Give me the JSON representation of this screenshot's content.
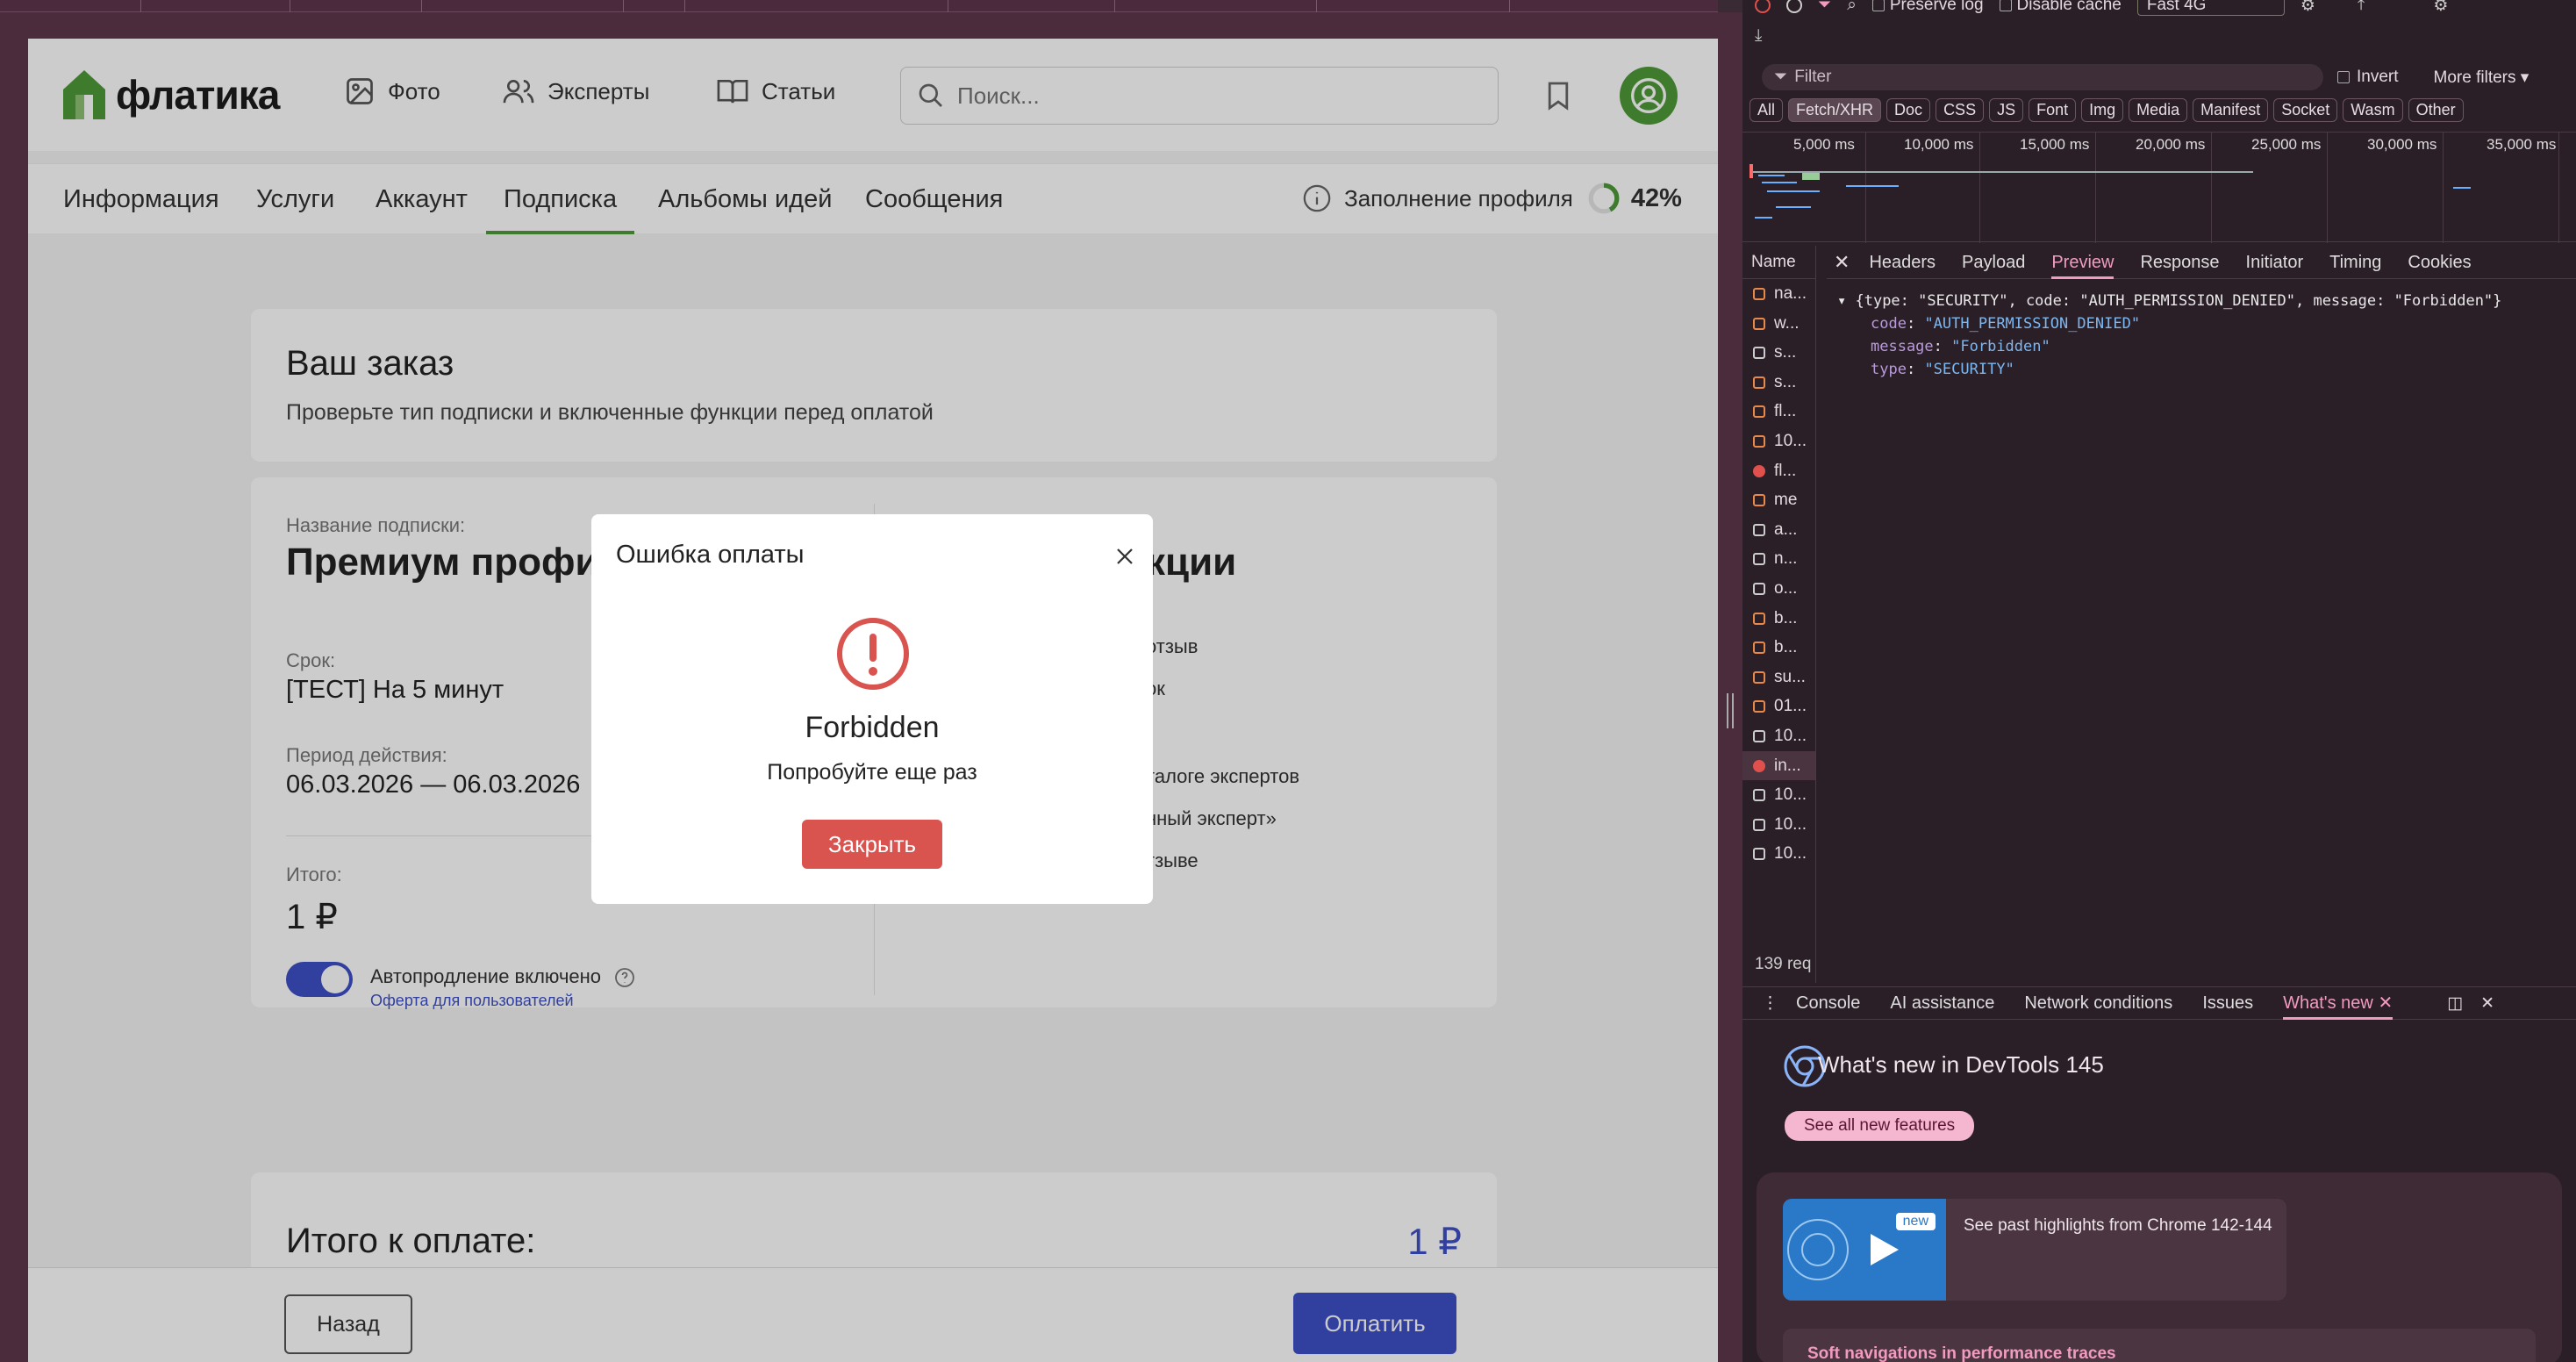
{
  "app": {
    "logo_text": "флатика",
    "nav": {
      "photo": "Фото",
      "experts": "Эксперты",
      "articles": "Статьи"
    },
    "search_placeholder": "Поиск...",
    "tabs": [
      "Информация",
      "Услуги",
      "Аккаунт",
      "Подписка",
      "Альбомы идей",
      "Сообщения"
    ],
    "active_tab": "Подписка",
    "profile_fill": {
      "label": "Заполнение профиля",
      "value": "42%",
      "fraction": 0.42
    },
    "order": {
      "title": "Ваш заказ",
      "subtitle": "Проверьте тип подписки и включенные функции перед оплатой"
    },
    "details": {
      "name_label": "Название подписки:",
      "name_value": "Премиум профиль",
      "term_label": "Срок:",
      "term_value": "[ТЕСТ] На 5 минут",
      "period_label": "Период действия:",
      "period_value": "06.03.2026 — 06.03.2026",
      "total_label": "Итого:",
      "total_value": "1 ₽",
      "autorenew": "Автопродление включено",
      "offer_link": "Оферта для пользователей",
      "features_title_fragment": "кции",
      "features": [
        "отзыв",
        "ок",
        "талоге экспертов",
        "нный эксперт»",
        "тзыве"
      ]
    },
    "total_to_pay": {
      "label": "Итого к оплате:",
      "value": "1 ₽"
    },
    "back_button": "Назад",
    "pay_button": "Оплатить",
    "modal": {
      "title": "Ошибка оплаты",
      "heading": "Forbidden",
      "message": "Попробуйте еще раз",
      "button": "Закрыть"
    },
    "colors": {
      "brand": "#4f9a38",
      "primary": "#3e4fc7",
      "error": "#d9534f"
    }
  },
  "devtools": {
    "toolbar": {
      "preserve_log": "Preserve log",
      "disable_cache": "Disable cache",
      "throttle": "Fast 4G"
    },
    "filter_placeholder": "Filter",
    "invert": "Invert",
    "more_filters": "More filters",
    "type_filters": [
      "All",
      "Fetch/XHR",
      "Doc",
      "CSS",
      "JS",
      "Font",
      "Img",
      "Media",
      "Manifest",
      "Socket",
      "Wasm",
      "Other"
    ],
    "active_type": "Fetch/XHR",
    "timeline_labels": [
      "5,000 ms",
      "10,000 ms",
      "15,000 ms",
      "20,000 ms",
      "25,000 ms",
      "30,000 ms",
      "35,000 ms"
    ],
    "name_header": "Name",
    "requests": [
      {
        "name": "na...",
        "icon": "xhr"
      },
      {
        "name": "w...",
        "icon": "xhr"
      },
      {
        "name": "s...",
        "icon": "doc"
      },
      {
        "name": "s...",
        "icon": "xhr"
      },
      {
        "name": "fl...",
        "icon": "img"
      },
      {
        "name": "10...",
        "icon": "xhr"
      },
      {
        "name": "fl...",
        "icon": "error"
      },
      {
        "name": "me",
        "icon": "xhr"
      },
      {
        "name": "a...",
        "icon": "doc"
      },
      {
        "name": "n...",
        "icon": "doc"
      },
      {
        "name": "o...",
        "icon": "doc"
      },
      {
        "name": "b...",
        "icon": "xhr"
      },
      {
        "name": "b...",
        "icon": "xhr"
      },
      {
        "name": "su...",
        "icon": "xhr"
      },
      {
        "name": "01...",
        "icon": "xhr"
      },
      {
        "name": "10...",
        "icon": "doc"
      },
      {
        "name": "in...",
        "icon": "error",
        "selected": true
      },
      {
        "name": "10...",
        "icon": "doc"
      },
      {
        "name": "10...",
        "icon": "doc"
      },
      {
        "name": "10...",
        "icon": "doc"
      }
    ],
    "detail_tabs": [
      "Headers",
      "Payload",
      "Preview",
      "Response",
      "Initiator",
      "Timing",
      "Cookies"
    ],
    "active_detail_tab": "Preview",
    "preview": {
      "summary": "{type: \"SECURITY\", code: \"AUTH_PERMISSION_DENIED\", message: \"Forbidden\"}",
      "fields": [
        {
          "key": "code",
          "value": "\"AUTH_PERMISSION_DENIED\""
        },
        {
          "key": "message",
          "value": "\"Forbidden\""
        },
        {
          "key": "type",
          "value": "\"SECURITY\""
        }
      ]
    },
    "request_count": "139 req",
    "drawer_tabs": [
      "Console",
      "AI assistance",
      "Network conditions",
      "Issues",
      "What's new"
    ],
    "active_drawer_tab": "What's new",
    "whats_new": {
      "title": "What's new in DevTools 145",
      "button": "See all new features",
      "badge": "new",
      "card_text": "See past highlights from Chrome 142-144",
      "next_item": "Soft navigations in performance traces"
    }
  }
}
